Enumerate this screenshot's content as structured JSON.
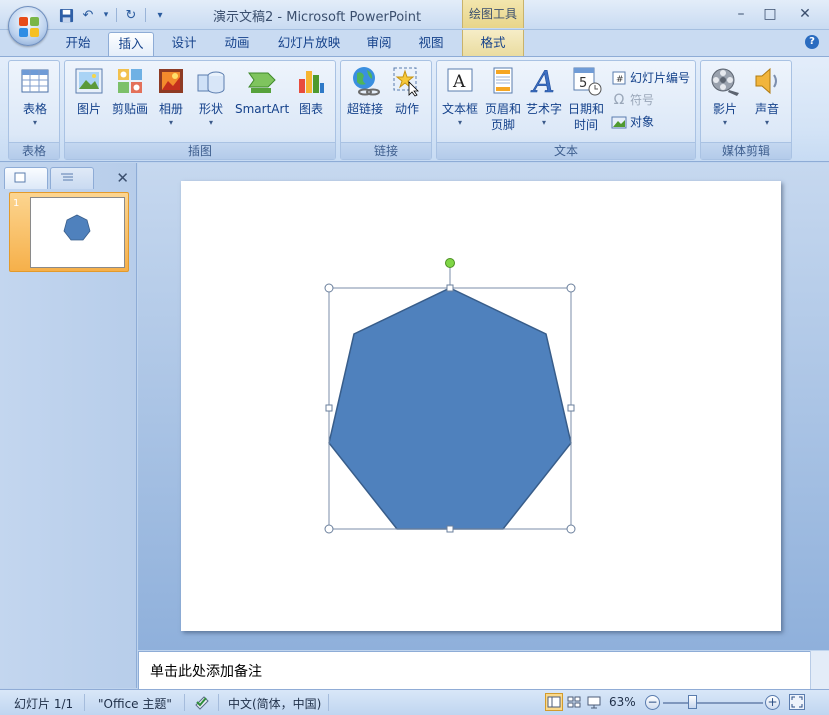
{
  "titlebar": {
    "title": "演示文稿2 - Microsoft PowerPoint",
    "context_tab_header": "绘图工具",
    "minimize": "–",
    "maximize": "□",
    "close": "✕"
  },
  "quick_access": {
    "save": "save-icon",
    "undo": "↶",
    "redo": "↻",
    "customize": "▾"
  },
  "tabs": [
    {
      "label": "开始",
      "active": false
    },
    {
      "label": "插入",
      "active": true
    },
    {
      "label": "设计",
      "active": false
    },
    {
      "label": "动画",
      "active": false
    },
    {
      "label": "幻灯片放映",
      "active": false
    },
    {
      "label": "审阅",
      "active": false
    },
    {
      "label": "视图",
      "active": false
    },
    {
      "label": "格式",
      "active": false,
      "contextual": true
    }
  ],
  "ribbon": {
    "groups": {
      "table": {
        "label": "表格",
        "buttons": {
          "table": "表格"
        }
      },
      "illustrations": {
        "label": "插图",
        "buttons": {
          "picture": "图片",
          "clipart": "剪贴画",
          "album": "相册",
          "shapes": "形状",
          "smartart": "SmartArt",
          "chart": "图表"
        }
      },
      "links": {
        "label": "链接",
        "buttons": {
          "hyperlink": "超链接",
          "action": "动作"
        }
      },
      "text": {
        "label": "文本",
        "buttons": {
          "textbox": "文本框",
          "header_footer_1": "页眉和",
          "header_footer_2": "页脚",
          "wordart": "艺术字",
          "datetime_1": "日期和",
          "datetime_2": "时间",
          "slide_number": "幻灯片编号",
          "symbol": "符号",
          "object": "对象"
        }
      },
      "media": {
        "label": "媒体剪辑",
        "buttons": {
          "movie": "影片",
          "sound": "声音"
        }
      }
    }
  },
  "left_panel": {
    "slide_number": "1",
    "close": "✕"
  },
  "notes": {
    "placeholder": "单击此处添加备注"
  },
  "status": {
    "slide": "幻灯片 1/1",
    "theme": "\"Office 主题\"",
    "language": "中文(简体，中国)",
    "zoom": "63%",
    "zoom_value": 63
  },
  "colors": {
    "shape_fill": "#4f81bd",
    "shape_stroke": "#385d8a",
    "rotation_handle": "#7fd646"
  }
}
